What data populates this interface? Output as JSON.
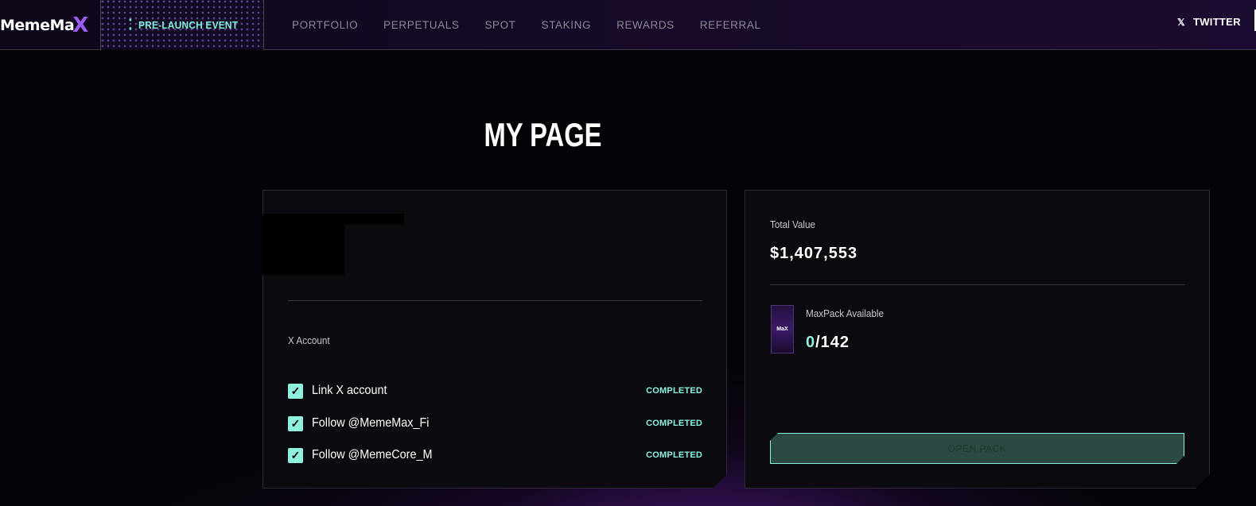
{
  "header": {
    "logo_text": "MemeMa",
    "logo_mark": "X",
    "event_label": "PRE-LAUNCH EVENT",
    "nav": [
      "PORTFOLIO",
      "PERPETUALS",
      "SPOT",
      "STAKING",
      "REWARDS",
      "REFERRAL"
    ],
    "twitter_label": "TWITTER"
  },
  "page": {
    "title": "MY PAGE"
  },
  "account_card": {
    "section_label": "X Account",
    "tasks": [
      {
        "label": "Link X account",
        "status": "COMPLETED"
      },
      {
        "label": "Follow @MemeMax_Fi",
        "status": "COMPLETED"
      },
      {
        "label": "Follow @MemeCore_M",
        "status": "COMPLETED"
      }
    ]
  },
  "value_card": {
    "total_label": "Total Value",
    "total_value": "$1,407,553",
    "pack_label": "MaxPack Available",
    "pack_available": "0",
    "pack_total": "/142",
    "open_pack_label": "OPEN PACK"
  },
  "colors": {
    "accent": "#8ef0dd",
    "brand_purple": "#9b5cf0",
    "background": "#050308"
  },
  "icons": {
    "event": "dots-icon",
    "twitter": "x-logo-icon",
    "check": "check-icon"
  }
}
